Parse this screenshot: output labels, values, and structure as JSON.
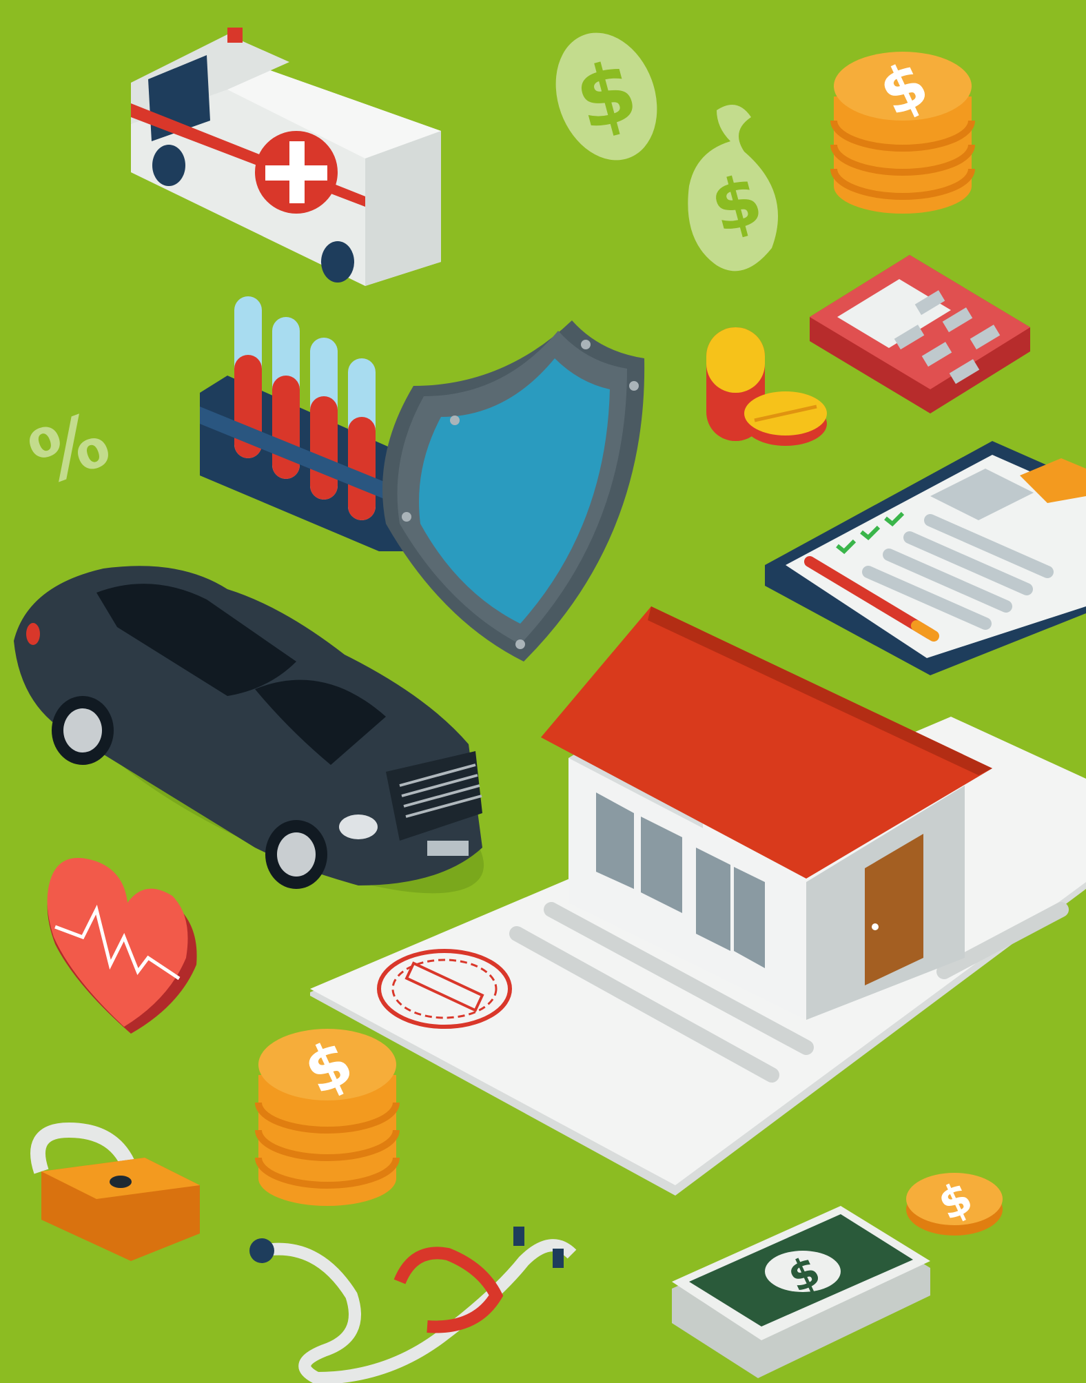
{
  "scene": {
    "description_free": true,
    "background_color": "#8cbc22",
    "accent_colors": {
      "red": "#d9372a",
      "orange": "#f39a1f",
      "navy": "#1e3d5c",
      "teal": "#2a9bbf",
      "gray": "#5b6a72",
      "paper": "#f3f4f3"
    }
  },
  "glyphs": {
    "dollar": "$",
    "percent": "%",
    "cross": "+"
  },
  "icons": [
    "ambulance-icon",
    "dollar-coin-icon",
    "money-bag-icon",
    "coin-stack-icon",
    "calculator-icon",
    "test-tubes-icon",
    "shield-icon",
    "pills-icon",
    "percent-icon",
    "clipboard-icon",
    "car-icon",
    "house-icon",
    "document-icon",
    "stamp-icon",
    "heart-icon",
    "padlock-icon",
    "stethoscope-icon",
    "banknotes-icon"
  ]
}
